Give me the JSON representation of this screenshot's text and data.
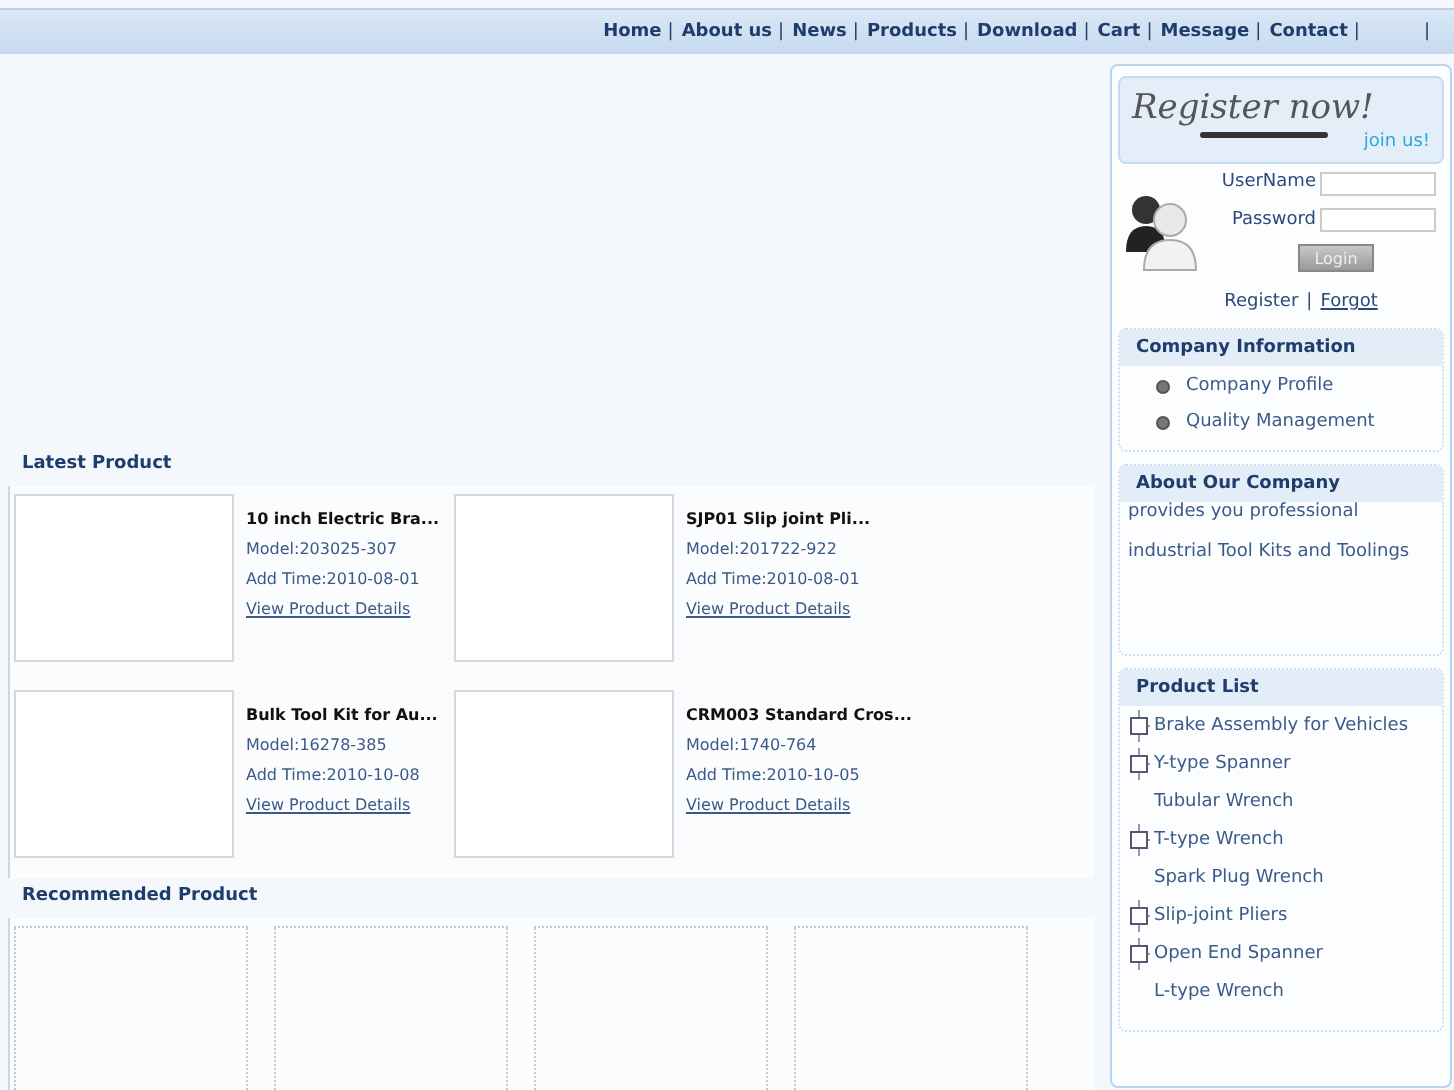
{
  "nav": {
    "items": [
      {
        "label": "Home",
        "separator": "|"
      },
      {
        "label": "About us",
        "separator": "|"
      },
      {
        "label": "News",
        "separator": "|"
      },
      {
        "label": "Products",
        "separator": "|"
      },
      {
        "label": "Download",
        "separator": "|"
      },
      {
        "label": "Cart",
        "separator": "|"
      },
      {
        "label": "Message",
        "separator": "|"
      },
      {
        "label": "Contact",
        "separator": "|"
      }
    ],
    "trailing_separator": "|"
  },
  "latest": {
    "title": "Latest Product",
    "products": [
      {
        "name": "10 inch Electric Bra...",
        "model": "Model:203025-307",
        "time": "Add Time:2010-08-01",
        "link": "View Product Details"
      },
      {
        "name": "SJP01 Slip joint Pli...",
        "model": "Model:201722-922",
        "time": "Add Time:2010-08-01",
        "link": "View Product Details"
      },
      {
        "name": "Bulk Tool Kit for Au...",
        "model": "Model:16278-385",
        "time": "Add Time:2010-10-08",
        "link": "View Product Details"
      },
      {
        "name": "CRM003 Standard Cros...",
        "model": "Model:1740-764",
        "time": "Add Time:2010-10-05",
        "link": "View Product Details"
      }
    ]
  },
  "recommended": {
    "title": "Recommended Product",
    "images": [
      {
        "kind": "empty"
      },
      {
        "kind": "empty"
      },
      {
        "kind": "empty"
      },
      {
        "kind": "empty"
      }
    ]
  },
  "login": {
    "banner_title": "Register now!",
    "banner_sub": "join us!",
    "username_label": "UserName",
    "password_label": "Password",
    "login_button": "Login",
    "register_link": "Register",
    "separator": "|",
    "forgot_link": "Forgot"
  },
  "company_info": {
    "title": "Company Information",
    "items": [
      "Company Profile",
      "Quality Management"
    ]
  },
  "about": {
    "title": "About Our Company",
    "lines": [
      "provides you professional",
      "industrial Tool Kits and Toolings"
    ]
  },
  "product_list": {
    "title": "Product List",
    "items": [
      {
        "label": "Brake Assembly for Vehicles",
        "expandable": true
      },
      {
        "label": "Y-type Spanner",
        "expandable": true
      },
      {
        "label": "Tubular Wrench",
        "expandable": false
      },
      {
        "label": "T-type Wrench",
        "expandable": true
      },
      {
        "label": "Spark Plug Wrench",
        "expandable": false
      },
      {
        "label": "Slip-joint Pliers",
        "expandable": true
      },
      {
        "label": "Open End Spanner",
        "expandable": true
      },
      {
        "label": "L-type Wrench",
        "expandable": false
      }
    ]
  }
}
